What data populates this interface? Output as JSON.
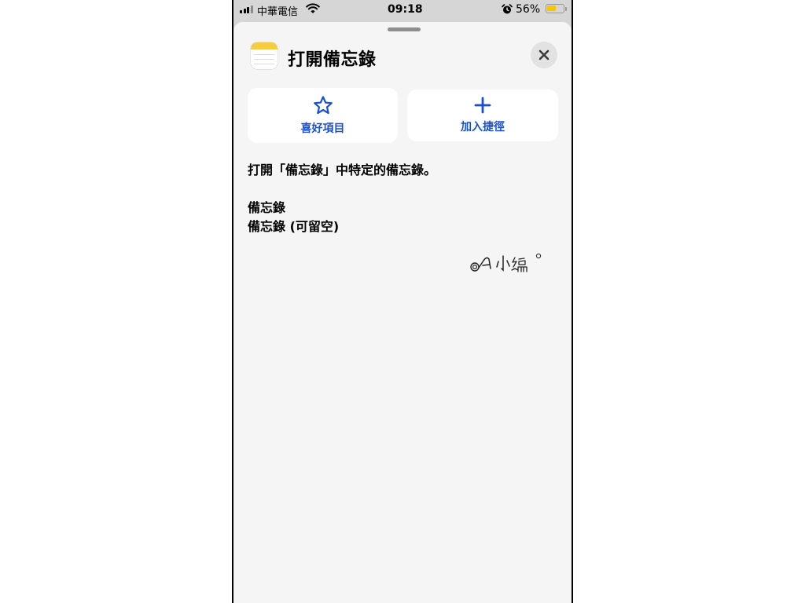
{
  "status_bar": {
    "carrier": "中華電信",
    "time": "09:18",
    "battery_percent": "56%",
    "battery_level": 0.56,
    "icons": [
      "signal-icon",
      "wifi-icon",
      "alarm-icon",
      "battery-icon"
    ]
  },
  "sheet": {
    "title": "打開備忘錄",
    "app_icon": "notes-app-icon",
    "close_icon": "close-icon"
  },
  "actions": {
    "favorite_label": "喜好項目",
    "favorite_icon": "star-icon",
    "add_shortcut_label": "加入捷徑",
    "add_shortcut_icon": "plus-icon"
  },
  "content": {
    "description": "打開「備忘錄」中特定的備忘錄。",
    "param_name": "備忘錄",
    "param_value": "備忘錄 (可留空)"
  },
  "watermark": {
    "text": "A 小編",
    "style": "handwritten-logo"
  },
  "colors": {
    "accent": "#1a4fd0",
    "sheet_background": "#f5f5f5",
    "card_background": "#ffffff",
    "notes_yellow": "#f6cd42",
    "battery_yellow": "#f5c700"
  }
}
